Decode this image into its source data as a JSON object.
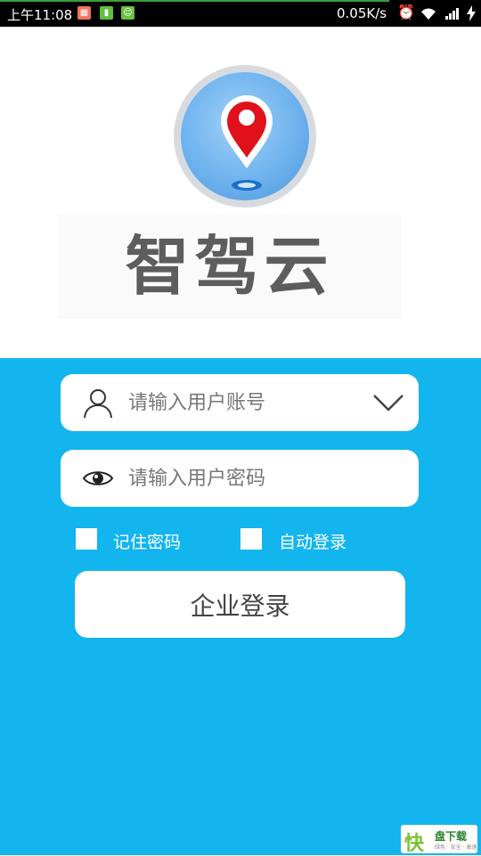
{
  "status_bar": {
    "time": "上午11:08",
    "net_speed": "0.05K/s",
    "icons": [
      "notification-icon",
      "battery-app-icon",
      "android-icon",
      "alarm-icon",
      "wifi-icon",
      "signal-icon",
      "charging-icon"
    ],
    "colors": {
      "notif1": "#f0745a",
      "notif2": "#5fbf3f",
      "notif3": "#6ac043",
      "progress": "#3c9e3c"
    }
  },
  "header": {
    "app_name": "智驾云",
    "logo_icon": "location-pin-icon",
    "colors": {
      "pin": "#e0111b",
      "circle": "#6fb3ee",
      "text": "#5d5d5d"
    }
  },
  "login": {
    "account_placeholder": "请输入用户账号",
    "password_placeholder": "请输入用户密码",
    "remember_label": "记住密码",
    "auto_login_label": "自动登录",
    "submit_label": "企业登录",
    "icons": [
      "user-icon",
      "eye-icon",
      "chevron-down-icon"
    ]
  },
  "watermark": {
    "mark": "快",
    "title": "盘下载",
    "subtitle": "绿色 · 安全 · 高速"
  },
  "theme": {
    "primary": "#13b5ef",
    "field_bg": "#ffffff"
  }
}
